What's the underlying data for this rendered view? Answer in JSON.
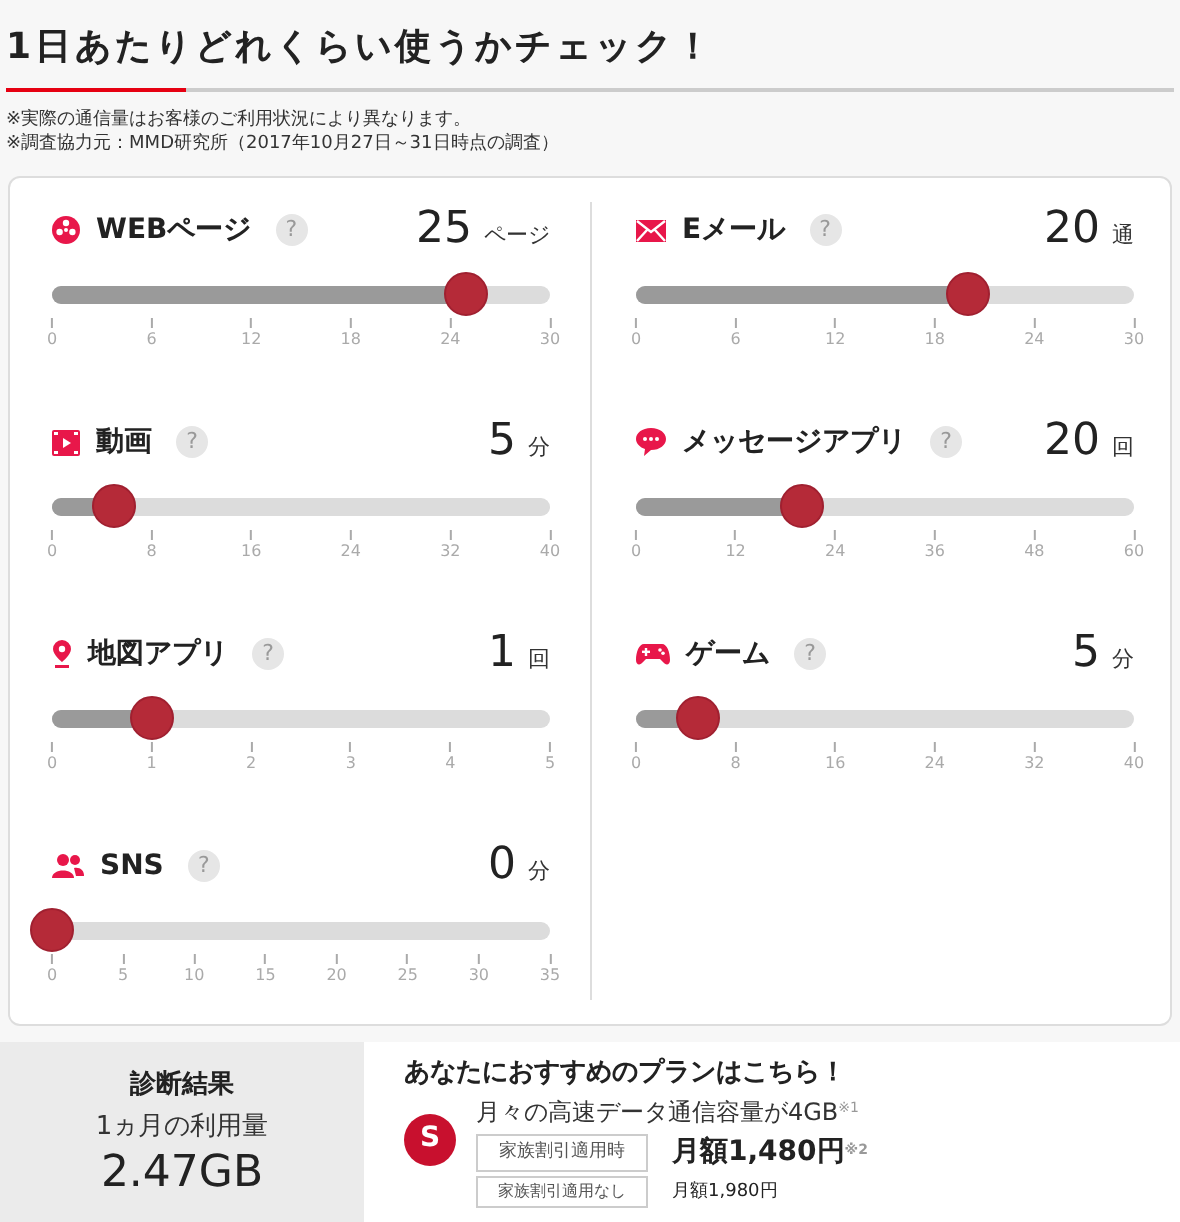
{
  "header": {
    "title": "1日あたりどれくらい使うかチェック！",
    "notes": [
      "※実際の通信量はお客様のご利用状況により異なります。",
      "※調査協力元：MMD研究所（2017年10月27日～31日時点の調査）"
    ]
  },
  "help_label": "?",
  "left_column": [
    {
      "kind": "web",
      "label": "WEBページ",
      "value": "25",
      "unit": "ページ",
      "level": 0.833,
      "ticks": [
        "0",
        "6",
        "12",
        "18",
        "24",
        "30"
      ]
    },
    {
      "kind": "video",
      "label": "動画",
      "value": "5",
      "unit": "分",
      "level": 0.125,
      "ticks": [
        "0",
        "8",
        "16",
        "24",
        "32",
        "40"
      ]
    },
    {
      "kind": "map",
      "label": "地図アプリ",
      "value": "1",
      "unit": "回",
      "level": 0.2,
      "ticks": [
        "0",
        "1",
        "2",
        "3",
        "4",
        "5"
      ]
    },
    {
      "kind": "sns",
      "label": "SNS",
      "value": "0",
      "unit": "分",
      "level": 0,
      "ticks": [
        "0",
        "5",
        "10",
        "15",
        "20",
        "25",
        "30",
        "35"
      ]
    }
  ],
  "right_column": [
    {
      "kind": "mail",
      "label": "Eメール",
      "value": "20",
      "unit": "通",
      "level": 0.667,
      "ticks": [
        "0",
        "6",
        "12",
        "18",
        "24",
        "30"
      ]
    },
    {
      "kind": "message",
      "label": "メッセージアプリ",
      "value": "20",
      "unit": "回",
      "level": 0.333,
      "ticks": [
        "0",
        "12",
        "24",
        "36",
        "48",
        "60"
      ]
    },
    {
      "kind": "game",
      "label": "ゲーム",
      "value": "5",
      "unit": "分",
      "level": 0.125,
      "ticks": [
        "0",
        "8",
        "16",
        "24",
        "32",
        "40"
      ]
    }
  ],
  "result": {
    "title": "診断結果",
    "label": "1ヵ月の利用量",
    "value": "2.47GB"
  },
  "plan": {
    "heading": "あなたにおすすめのプランはこちら！",
    "badge": "S",
    "capacity": "月々の高速データ通信容量が4GB$^{※1}$",
    "prices": [
      {
        "tag": "家族割引適用時",
        "price": "月額1,480円$^{※2}$",
        "emphasis": true
      },
      {
        "tag": "家族割引適用なし",
        "price": "月額1,980円",
        "emphasis": false
      }
    ]
  }
}
